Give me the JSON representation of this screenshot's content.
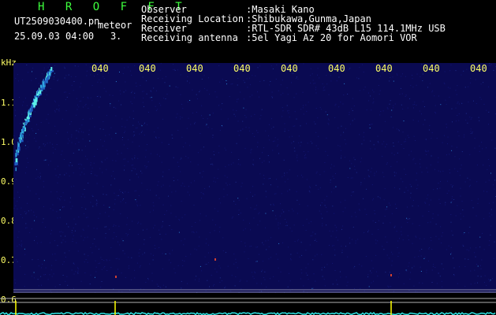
{
  "header": {
    "title": "H R O F F T",
    "filename": "UT2509030400.pn",
    "filetype": "meteor",
    "datetime": "25.09.03 04:00",
    "count": "3",
    "fields": [
      {
        "label": "Observer",
        "value": ":Masaki Kano"
      },
      {
        "label": "Receiving Location",
        "value": ":Shibukawa,Gunma,Japan"
      },
      {
        "label": "Receiver",
        "value": ":RTL-SDR SDR# 43dB L15 114.1MHz USB"
      },
      {
        "label": "Receiving antenna",
        "value": ":5el Yagi Az 20 for Aomori VOR"
      }
    ]
  },
  "axis": {
    "y_unit": "kHz",
    "y_ticks": [
      "1.1",
      "1.0",
      "0.9",
      "0.8",
      "0.7",
      "0.6"
    ],
    "x_ticks": [
      "040",
      "040",
      "040",
      "040",
      "040",
      "040",
      "040",
      "040",
      "040",
      "0410"
    ]
  },
  "colors": {
    "background": "#000000",
    "spectrogram": "#0a0a52",
    "axis_text": "#ffff66",
    "title": "#3dff3d",
    "noise": "#2ee6e6",
    "marker": "#ffff00"
  }
}
